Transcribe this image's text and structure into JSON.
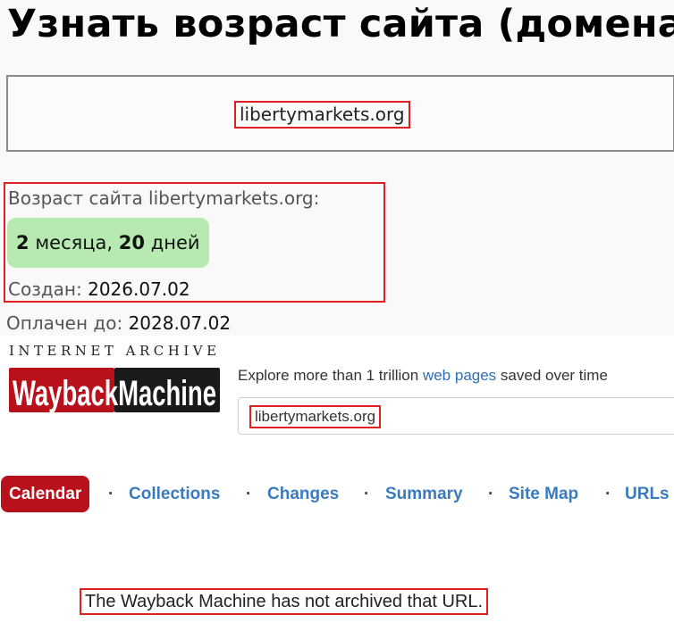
{
  "age_tool": {
    "title": "Узнать возраст сайта (домена)",
    "domain_input_value": "libertymarkets.org",
    "age_label": "Возраст сайта libertymarkets.org:",
    "age_months_number": "2",
    "age_months_word": "месяца,",
    "age_days_number": "20",
    "age_days_word": "дней",
    "created_label": "Создан:",
    "created_value": "2026.07.02",
    "paid_label": "Оплачен до:",
    "paid_value": "2028.07.02",
    "colors": {
      "age_pill": "#b7eab0",
      "highlight_border": "#e02020"
    }
  },
  "wayback": {
    "logo_top_text": "INTERNET ARCHIVE",
    "logo_brand_text": "WaybackMachine",
    "tagline_prefix": "Explore more than 1 trillion",
    "tagline_link": "web pages",
    "tagline_suffix": "saved over time",
    "search_value": "libertymarkets.org",
    "nav": [
      {
        "label": "Calendar",
        "active": true
      },
      {
        "label": "Collections"
      },
      {
        "label": "Changes"
      },
      {
        "label": "Summary"
      },
      {
        "label": "Site Map"
      },
      {
        "label": "URLs"
      }
    ],
    "nav_separator": "·",
    "message": "The Wayback Machine has not archived that URL.",
    "colors": {
      "brand_red": "#b8111b",
      "link_blue": "#3a7bc0"
    }
  }
}
